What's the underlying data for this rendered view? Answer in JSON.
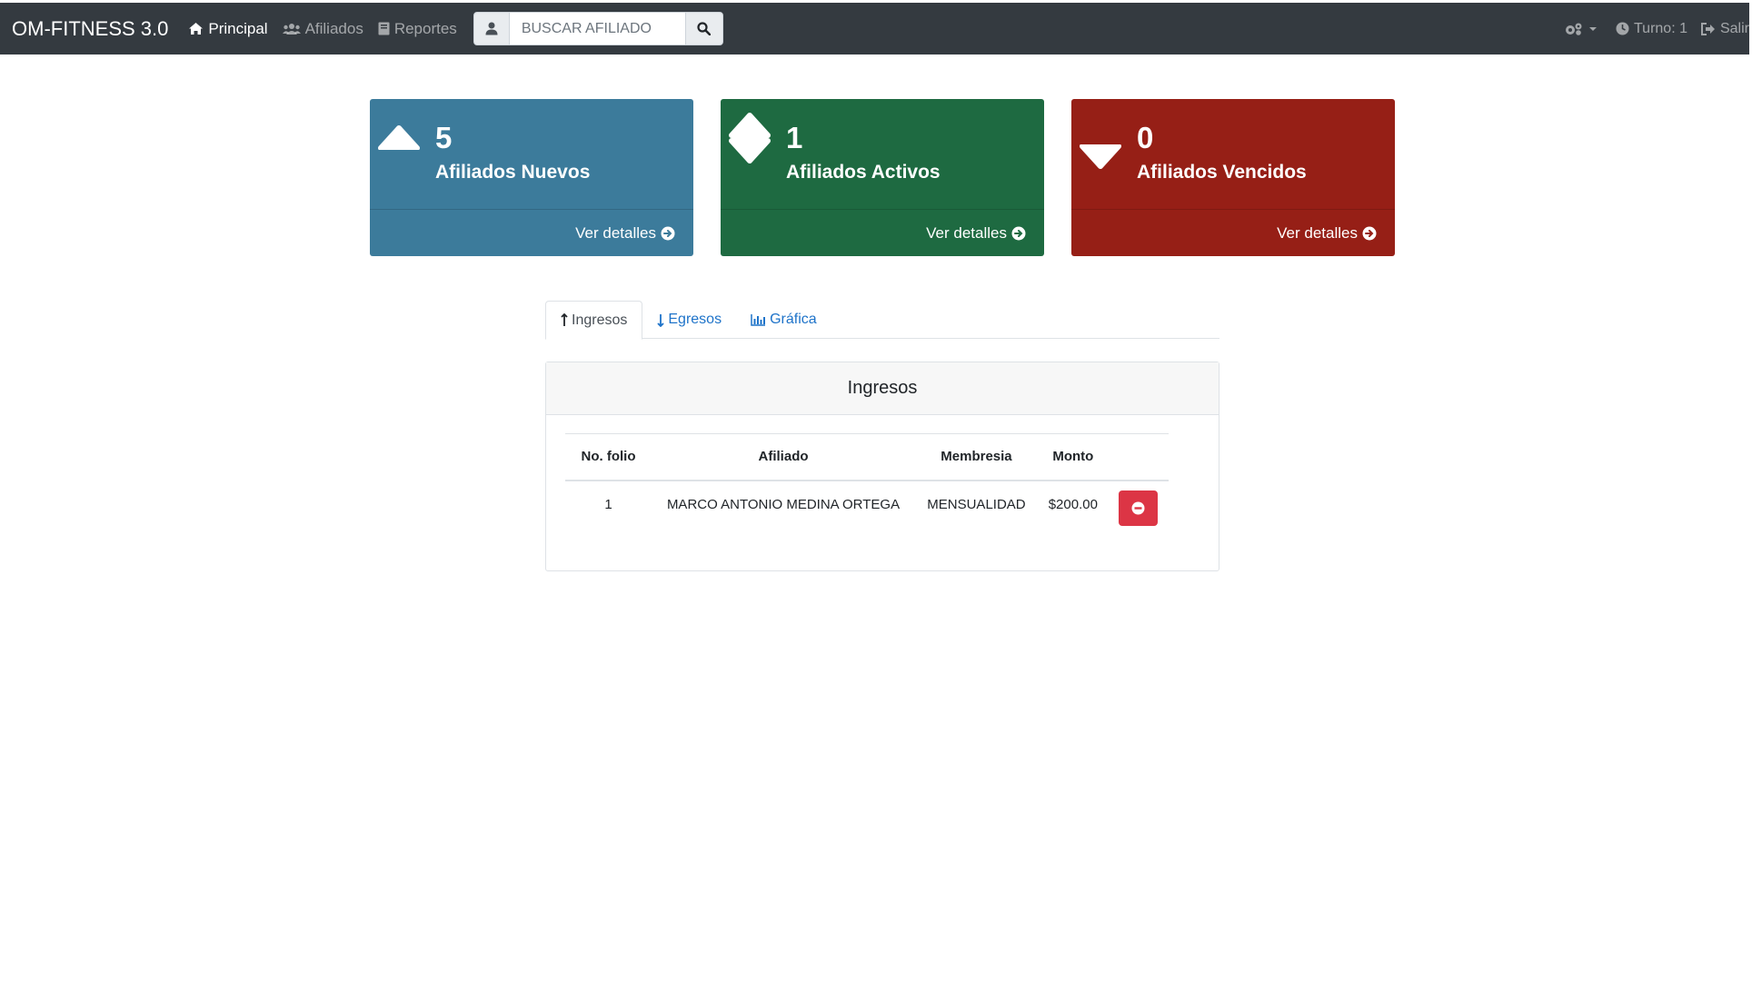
{
  "navbar": {
    "brand": "OM-FITNESS 3.0",
    "links": [
      {
        "label": "Principal",
        "icon": "home-icon",
        "active": true
      },
      {
        "label": "Afiliados",
        "icon": "users-icon",
        "active": false
      },
      {
        "label": "Reportes",
        "icon": "book-icon",
        "active": false
      }
    ],
    "search": {
      "placeholder": "BUSCAR AFILIADO",
      "value": ""
    },
    "right": {
      "settings_icon": "cogs-icon",
      "turno_label": "Turno: 1",
      "logout_label": "Salir"
    }
  },
  "cards": [
    {
      "count": "5",
      "label": "Afiliados Nuevos",
      "link": "Ver detalles",
      "color": "#3c7b9b"
    },
    {
      "count": "1",
      "label": "Afiliados Activos",
      "link": "Ver detalles",
      "color": "#1e6a41"
    },
    {
      "count": "0",
      "label": "Afiliados Vencidos",
      "link": "Ver detalles",
      "color": "#961f16"
    }
  ],
  "tabs": [
    {
      "label": "Ingresos",
      "icon": "arrow-up-icon",
      "active": true
    },
    {
      "label": "Egresos",
      "icon": "arrow-down-icon",
      "active": false
    },
    {
      "label": "Gráfica",
      "icon": "bar-chart-icon",
      "active": false
    }
  ],
  "panel": {
    "title": "Ingresos",
    "columns": [
      "No. folio",
      "Afiliado",
      "Membresia",
      "Monto",
      ""
    ],
    "rows": [
      {
        "folio": "1",
        "afiliado": "MARCO ANTONIO MEDINA ORTEGA",
        "membresia": "MENSUALIDAD",
        "monto": "$200.00"
      }
    ],
    "delete_color": "#dc3545"
  }
}
